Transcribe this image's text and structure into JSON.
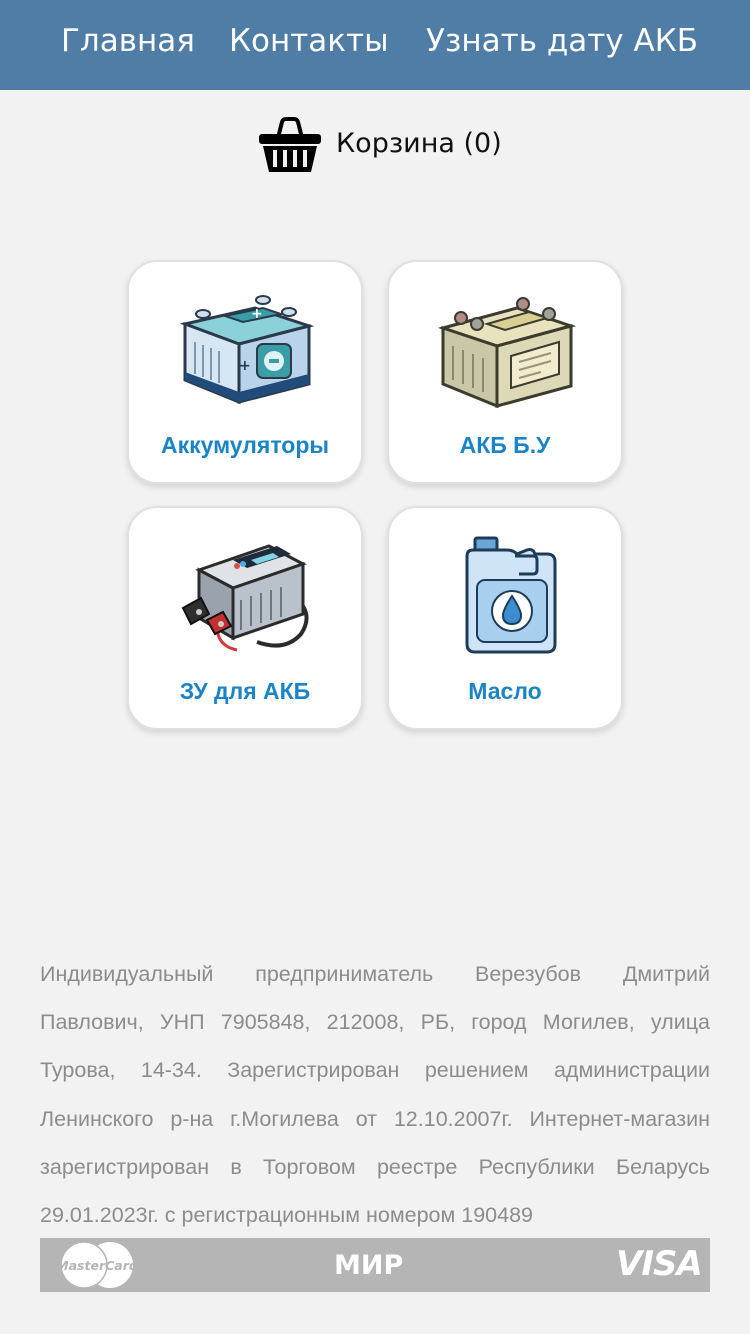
{
  "nav": {
    "items": [
      {
        "label": "Главная"
      },
      {
        "label": "Контакты"
      },
      {
        "label": "Узнать дату АКБ"
      }
    ]
  },
  "cart": {
    "label": "Корзина (0)",
    "icon": "basket-icon"
  },
  "categories": [
    {
      "label": "Аккумуляторы",
      "icon": "new-battery-icon"
    },
    {
      "label": "АКБ Б.У",
      "icon": "used-battery-icon"
    },
    {
      "label": "ЗУ для АКБ",
      "icon": "battery-charger-icon"
    },
    {
      "label": "Масло",
      "icon": "oil-canister-icon"
    }
  ],
  "footer": {
    "text": "Индивидуальный предприниматель Верезубов Дмитрий Павлович, УНП 7905848, 212008, РБ, город Могилев, улица Турова, 14-34. Зарегистрирован решением администрации Ленинского р-на г.Могилева от 12.10.2007г. Интернет-магазин зарегистрирован в Торговом реестре Республики Беларусь 29.01.2023г. с регистрационным номером 190489",
    "payments": {
      "mastercard": "MasterCard",
      "mir": "МИР",
      "visa": "VISA"
    }
  },
  "colors": {
    "header_bg": "#4f7da6",
    "accent_link": "#1a84c6",
    "page_bg": "#f2f2f2",
    "footer_text": "#8c8c8c",
    "payments_bar": "#b5b5b5"
  }
}
